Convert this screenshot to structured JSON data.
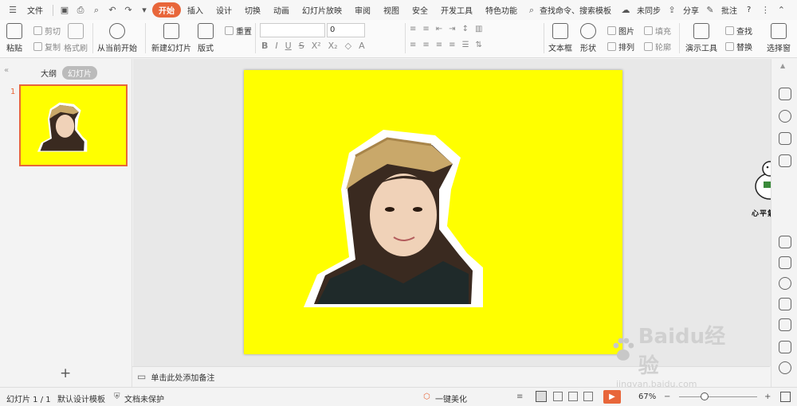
{
  "menu": {
    "file": "文件",
    "tabs": [
      "开始",
      "插入",
      "设计",
      "切换",
      "动画",
      "幻灯片放映",
      "审阅",
      "视图",
      "安全",
      "开发工具",
      "特色功能"
    ],
    "search": "查找命令、搜索模板",
    "sync": "未同步",
    "share": "分享",
    "comment": "批注",
    "help": "?"
  },
  "ribbon": {
    "paste": "粘贴",
    "cut": "剪切",
    "copy": "复制",
    "format_painter": "格式刷",
    "play_from_current": "从当前开始",
    "new_slide": "新建幻灯片",
    "layout": "版式",
    "reset": "重置",
    "font_size": "0",
    "textbox": "文本框",
    "shapes": "形状",
    "picture": "图片",
    "fill": "填充",
    "arrange": "排列",
    "outline": "轮廓",
    "present_tools": "演示工具",
    "find": "查找",
    "replace": "替换",
    "select_pane": "选择窗"
  },
  "left": {
    "tab_outline": "大纲",
    "tab_slides": "幻灯片",
    "slide_number": "1",
    "add": "+"
  },
  "notes": {
    "placeholder": "单击此处添加备注"
  },
  "watermark": {
    "sticker_text": "心平氣和鴨",
    "brand": "Baidu经验",
    "url": "jingyan.baidu.com"
  },
  "status": {
    "slide_count": "幻灯片 1 / 1",
    "template": "默认设计模板",
    "protect": "文档未保护",
    "beautify": "一键美化",
    "zoom": "67%"
  },
  "colors": {
    "accent": "#e8663a",
    "slide_bg": "#ffff00"
  }
}
